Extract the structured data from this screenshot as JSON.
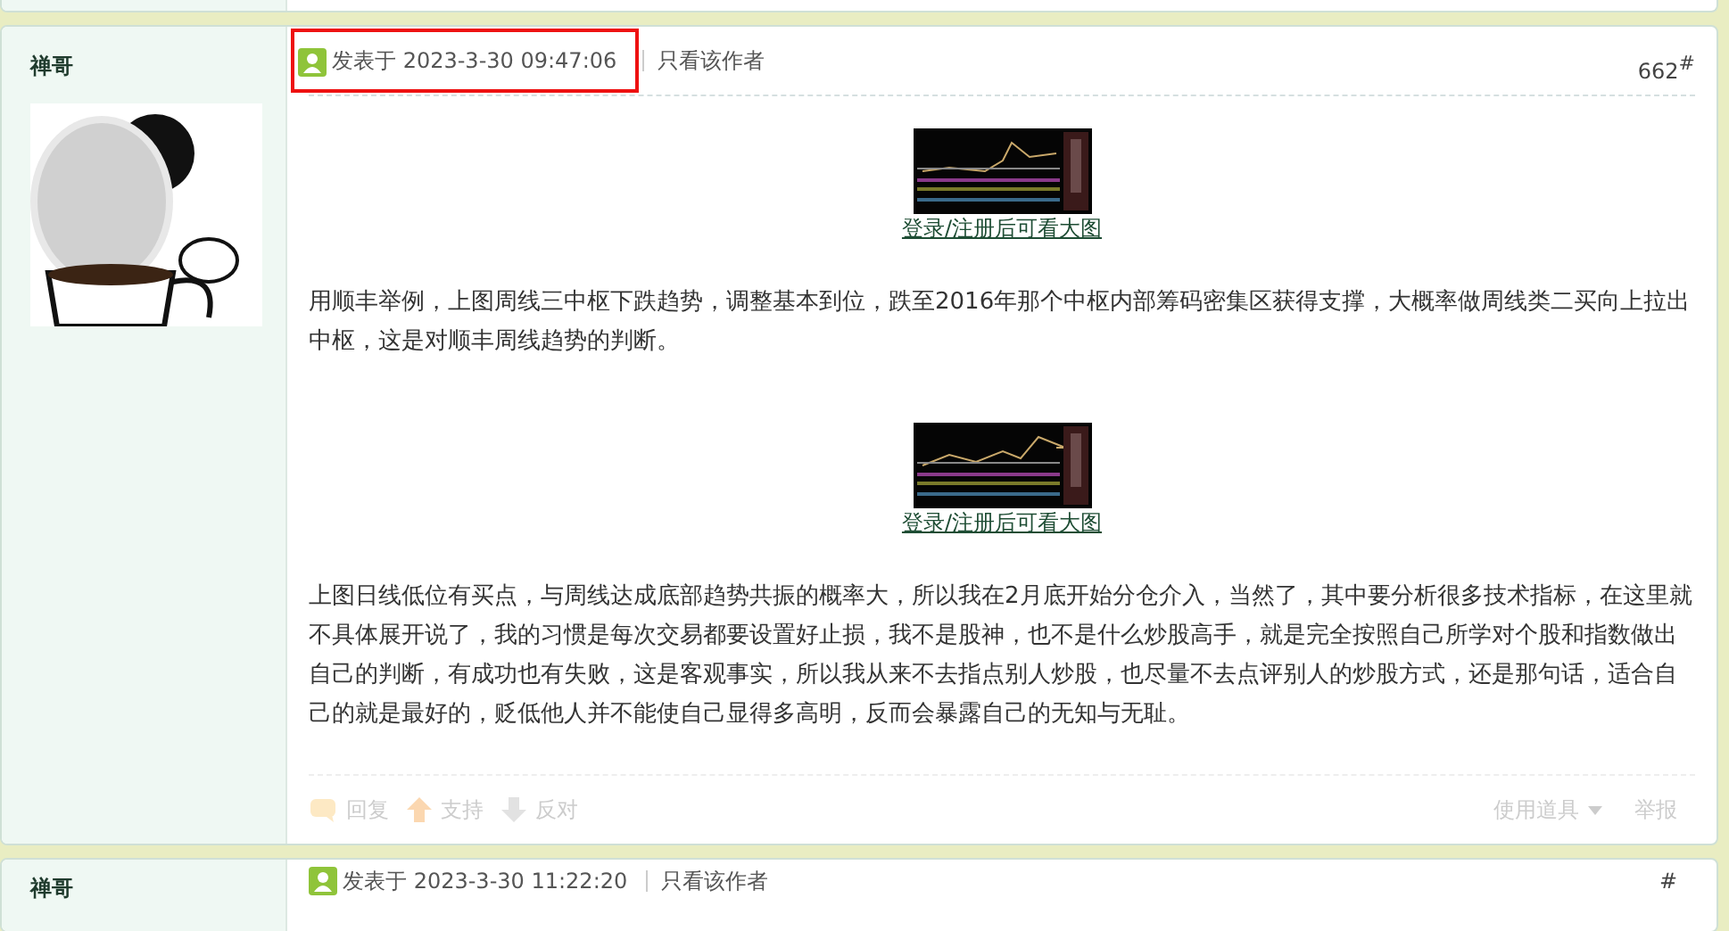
{
  "post": {
    "author": "禅哥",
    "time_label": "发表于 2023-3-30 09:47:06",
    "highlighted": true,
    "author_only": "只看该作者",
    "floor": "662$^{#}$",
    "content": [
      {
        "caption": "登录/注册后可看大图"
      },
      {
        "kind": "text",
        "text": "用顺丰举例，上图周线三中枢下跌趋势，调整基本到位，跌至2016年那个中枢内部筹码密集区获得支撑，大概率做周线类二买向上拉出中枢，这是对顺丰周线趋势的判断。"
      },
      {
        "caption": "登录/注册后可看大图"
      },
      {
        "kind": "text",
        "text": "上图日线低位有买点，与周线达成底部趋势共振的概率大，所以我在2月底开始分仓介入，当然了，其中要分析很多技术指标，在这里就不具体展开说了，我的习惯是每次交易都要设置好止损，我不是股神，也不是什么炒股高手，就是完全按照自己所学对个股和指数做出自己的判断，有成功也有失败，这是客观事实，所以我从来不去指点别人炒股，也尽量不去点评别人的炒股方式，还是那句话，适合自己的就是最好的，贬低他人并不能使自己显得多高明，反而会暴露自己的无知与无耻。"
      }
    ],
    "actions": [
      {
        "kind": "reply",
        "label": "回复"
      },
      {
        "kind": "up",
        "label": "支持"
      },
      {
        "kind": "down",
        "label": "反对"
      }
    ],
    "tools": "使用道具",
    "report": "举报"
  },
  "next_post": {
    "author": "禅哥",
    "time_label": "发表于 2023-3-30 11:22:20",
    "author_only": "只看该作者",
    "floor": "#"
  }
}
